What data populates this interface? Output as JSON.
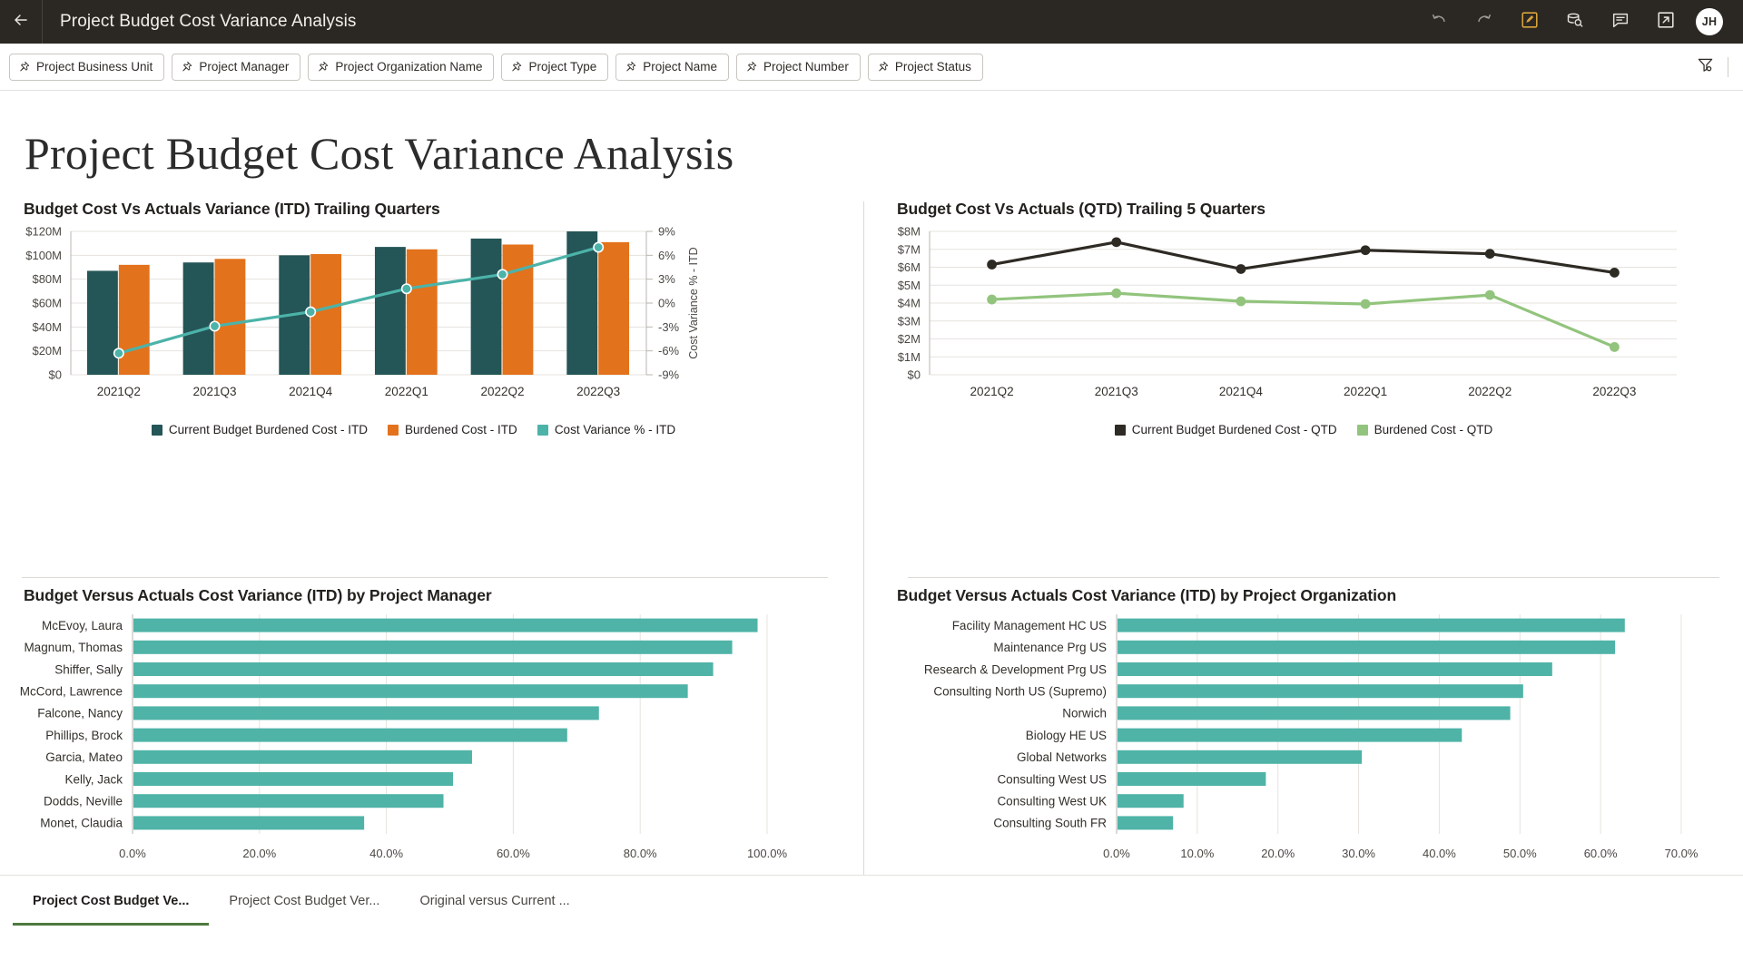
{
  "topbar": {
    "back_icon": "back-arrow-icon",
    "app_title": "Project Budget Cost Variance Analysis",
    "icons": [
      {
        "name": "undo-icon",
        "label": "Undo"
      },
      {
        "name": "redo-icon",
        "label": "Redo"
      },
      {
        "name": "edit-icon",
        "label": "Edit"
      },
      {
        "name": "data-icon",
        "label": "Data"
      },
      {
        "name": "comment-icon",
        "label": "Comments"
      },
      {
        "name": "share-icon",
        "label": "Share"
      }
    ],
    "avatar_initials": "JH",
    "edit_icon_color": "#d8a43c"
  },
  "filters": {
    "chips": [
      "Project Business Unit",
      "Project Manager",
      "Project Organization Name",
      "Project Type",
      "Project Name",
      "Project Number",
      "Project Status"
    ],
    "pin_icon": "pin-icon",
    "filter_icon": "filter-funnel-icon"
  },
  "page": {
    "title": "Project Budget Cost Variance Analysis"
  },
  "tabs": [
    {
      "label": "Project Cost Budget Ve...",
      "active": true
    },
    {
      "label": "Project Cost Budget Ver...",
      "active": false
    },
    {
      "label": "Original versus Current ...",
      "active": false
    }
  ],
  "colors": {
    "teal_dark": "#245557",
    "orange": "#e3721c",
    "teal_line": "#4cb3a9",
    "near_black": "#2e2a24",
    "green": "#92c47d",
    "bar_teal": "#4fb3a7",
    "tab_active": "#4e7a3f"
  },
  "chart_data": [
    {
      "id": "chart-itd-trailing-quarters",
      "type": "bar",
      "title": "Budget Cost Vs Actuals Variance (ITD) Trailing Quarters",
      "categories": [
        "2021Q2",
        "2021Q3",
        "2021Q4",
        "2022Q1",
        "2022Q2",
        "2022Q3"
      ],
      "series": [
        {
          "name": "Current Budget Burdened Cost - ITD",
          "type": "bar",
          "axis": "left",
          "color": "#245557",
          "values": [
            87,
            94,
            100,
            107,
            114,
            120
          ]
        },
        {
          "name": "Burdened Cost - ITD",
          "type": "bar",
          "axis": "left",
          "color": "#e3721c",
          "values": [
            92,
            97,
            101,
            105,
            109,
            111
          ]
        },
        {
          "name": "Cost Variance % - ITD",
          "type": "line",
          "axis": "right",
          "color": "#4cb3a9",
          "values": [
            -6.3,
            -2.9,
            -1.1,
            1.8,
            3.6,
            7.0
          ]
        }
      ],
      "ylabel": "",
      "ylim": [
        0,
        120
      ],
      "yticks": [
        "$0",
        "$20M",
        "$40M",
        "$60M",
        "$80M",
        "$100M",
        "$120M"
      ],
      "y2label": "Cost Variance % - ITD",
      "y2lim": [
        -9,
        9
      ],
      "y2ticks": [
        "-9%",
        "-6%",
        "-3%",
        "0%",
        "3%",
        "6%",
        "9%"
      ],
      "xlabel": "",
      "grid": true,
      "legend_position": "bottom"
    },
    {
      "id": "chart-qtd-trailing-5-quarters",
      "type": "line",
      "title": "Budget Cost Vs Actuals (QTD) Trailing 5 Quarters",
      "categories": [
        "2021Q2",
        "2021Q3",
        "2021Q4",
        "2022Q1",
        "2022Q2",
        "2022Q3"
      ],
      "series": [
        {
          "name": "Current Budget Burdened Cost - QTD",
          "color": "#2e2a24",
          "values": [
            6.15,
            7.4,
            5.9,
            6.95,
            6.75,
            5.7
          ]
        },
        {
          "name": "Burdened Cost - QTD",
          "color": "#92c47d",
          "values": [
            4.2,
            4.55,
            4.1,
            3.95,
            4.45,
            1.55
          ]
        }
      ],
      "ylabel": "",
      "ylim": [
        0,
        8
      ],
      "yticks": [
        "$0",
        "$1M",
        "$2M",
        "$3M",
        "$4M",
        "$5M",
        "$6M",
        "$7M",
        "$8M"
      ],
      "xlabel": "",
      "grid": true,
      "legend_position": "bottom"
    },
    {
      "id": "chart-variance-by-project-manager",
      "type": "bar",
      "orientation": "horizontal",
      "title": "Budget Versus Actuals Cost Variance (ITD) by Project Manager",
      "categories": [
        "McEvoy, Laura",
        "Magnum, Thomas",
        "Shiffer, Sally",
        "McCord, Lawrence",
        "Falcone, Nancy",
        "Phillips, Brock",
        "Garcia, Mateo",
        "Kelly, Jack",
        "Dodds, Neville",
        "Monet, Claudia"
      ],
      "values": [
        98.5,
        94.5,
        91.5,
        87.5,
        73.5,
        68.5,
        53.5,
        50.5,
        49.0,
        36.5
      ],
      "color": "#4fb3a7",
      "xlim": [
        0,
        100
      ],
      "xticks": [
        "0.0%",
        "20.0%",
        "40.0%",
        "60.0%",
        "80.0%",
        "100.0%"
      ],
      "xtick_values": [
        0,
        20,
        40,
        60,
        80,
        100
      ],
      "ylabel": "",
      "xlabel": "",
      "grid": true
    },
    {
      "id": "chart-variance-by-project-organization",
      "type": "bar",
      "orientation": "horizontal",
      "title": "Budget Versus Actuals Cost Variance (ITD) by Project Organization",
      "categories": [
        "Facility Management HC US",
        "Maintenance Prg US",
        "Research & Development Prg US",
        "Consulting North US (Supremo)",
        "Norwich",
        "Biology HE US",
        "Global Networks",
        "Consulting West US",
        "Consulting West UK",
        "Consulting South FR"
      ],
      "values": [
        63.0,
        61.8,
        54.0,
        50.4,
        48.8,
        42.8,
        30.4,
        18.5,
        8.3,
        7.0
      ],
      "color": "#4fb3a7",
      "xlim": [
        0,
        70
      ],
      "xticks": [
        "0.0%",
        "10.0%",
        "20.0%",
        "30.0%",
        "40.0%",
        "50.0%",
        "60.0%",
        "70.0%"
      ],
      "xtick_values": [
        0,
        10,
        20,
        30,
        40,
        50,
        60,
        70
      ],
      "ylabel": "",
      "xlabel": "",
      "grid": true
    }
  ]
}
